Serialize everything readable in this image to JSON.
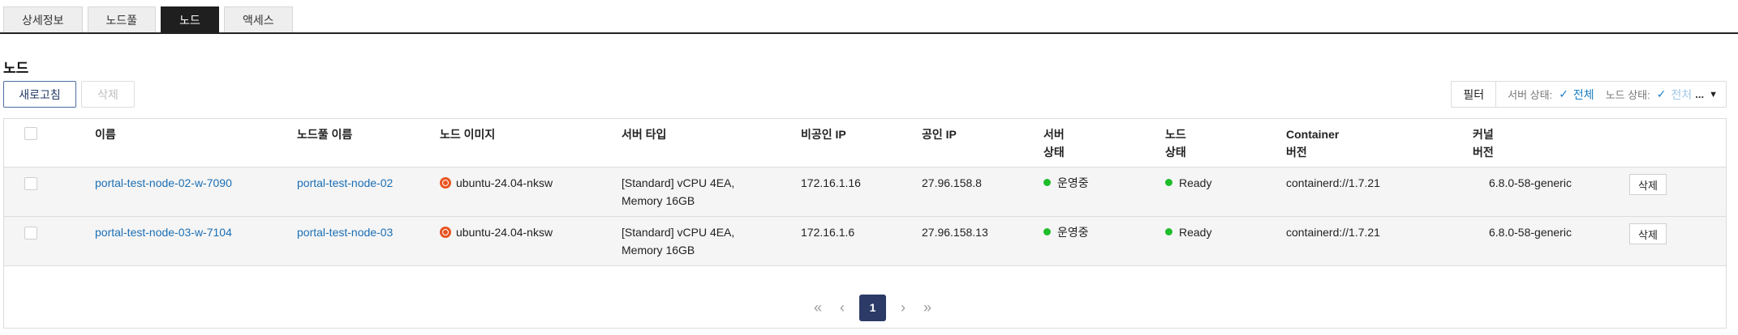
{
  "tabs": [
    {
      "label": "상세정보",
      "active": false
    },
    {
      "label": "노드풀",
      "active": false
    },
    {
      "label": "노드",
      "active": true
    },
    {
      "label": "액세스",
      "active": false
    }
  ],
  "section_title": "노드",
  "toolbar": {
    "refresh_label": "새로고침",
    "delete_label": "삭제",
    "filter_label": "필터",
    "server_status_label": "서버 상태:",
    "server_status_value": "전체",
    "node_status_label": "노드 상태:",
    "node_status_value": "전처",
    "node_status_more": "..."
  },
  "table": {
    "headers": {
      "name": "이름",
      "nodepool": "노드풀 이름",
      "image": "노드 이미지",
      "server_type": "서버 타입",
      "private_ip": "비공인 IP",
      "public_ip": "공인 IP",
      "server_status_1": "서버",
      "server_status_2": "상태",
      "node_status_1": "노드",
      "node_status_2": "상태",
      "container_1": "Container",
      "container_2": "버전",
      "kernel_1": "커널",
      "kernel_2": "버전"
    },
    "rows": [
      {
        "name": "portal-test-node-02-w-7090",
        "nodepool": "portal-test-node-02",
        "image": "ubuntu-24.04-nksw",
        "server_type_1": "[Standard] vCPU 4EA,",
        "server_type_2": "Memory 16GB",
        "private_ip": "172.16.1.16",
        "public_ip": "27.96.158.8",
        "server_status": "운영중",
        "node_status": "Ready",
        "container": "containerd://1.7.21",
        "kernel": "6.8.0-58-generic",
        "action": "삭제"
      },
      {
        "name": "portal-test-node-03-w-7104",
        "nodepool": "portal-test-node-03",
        "image": "ubuntu-24.04-nksw",
        "server_type_1": "[Standard] vCPU 4EA,",
        "server_type_2": "Memory 16GB",
        "private_ip": "172.16.1.6",
        "public_ip": "27.96.158.13",
        "server_status": "운영중",
        "node_status": "Ready",
        "container": "containerd://1.7.21",
        "kernel": "6.8.0-58-generic",
        "action": "삭제"
      }
    ]
  },
  "pagination": {
    "first": "«",
    "prev": "‹",
    "current": "1",
    "next": "›",
    "last": "»"
  },
  "colors": {
    "accent": "#1b6fb5",
    "active_tab": "#1f1f1f",
    "pager_active": "#2b3a66",
    "status_ok": "#1fbd2c",
    "ubuntu": "#e95420"
  },
  "icons": [
    "check-icon",
    "ubuntu-icon",
    "status-dot-icon",
    "caret-down-icon",
    "first-page-icon",
    "prev-page-icon",
    "next-page-icon",
    "last-page-icon"
  ]
}
